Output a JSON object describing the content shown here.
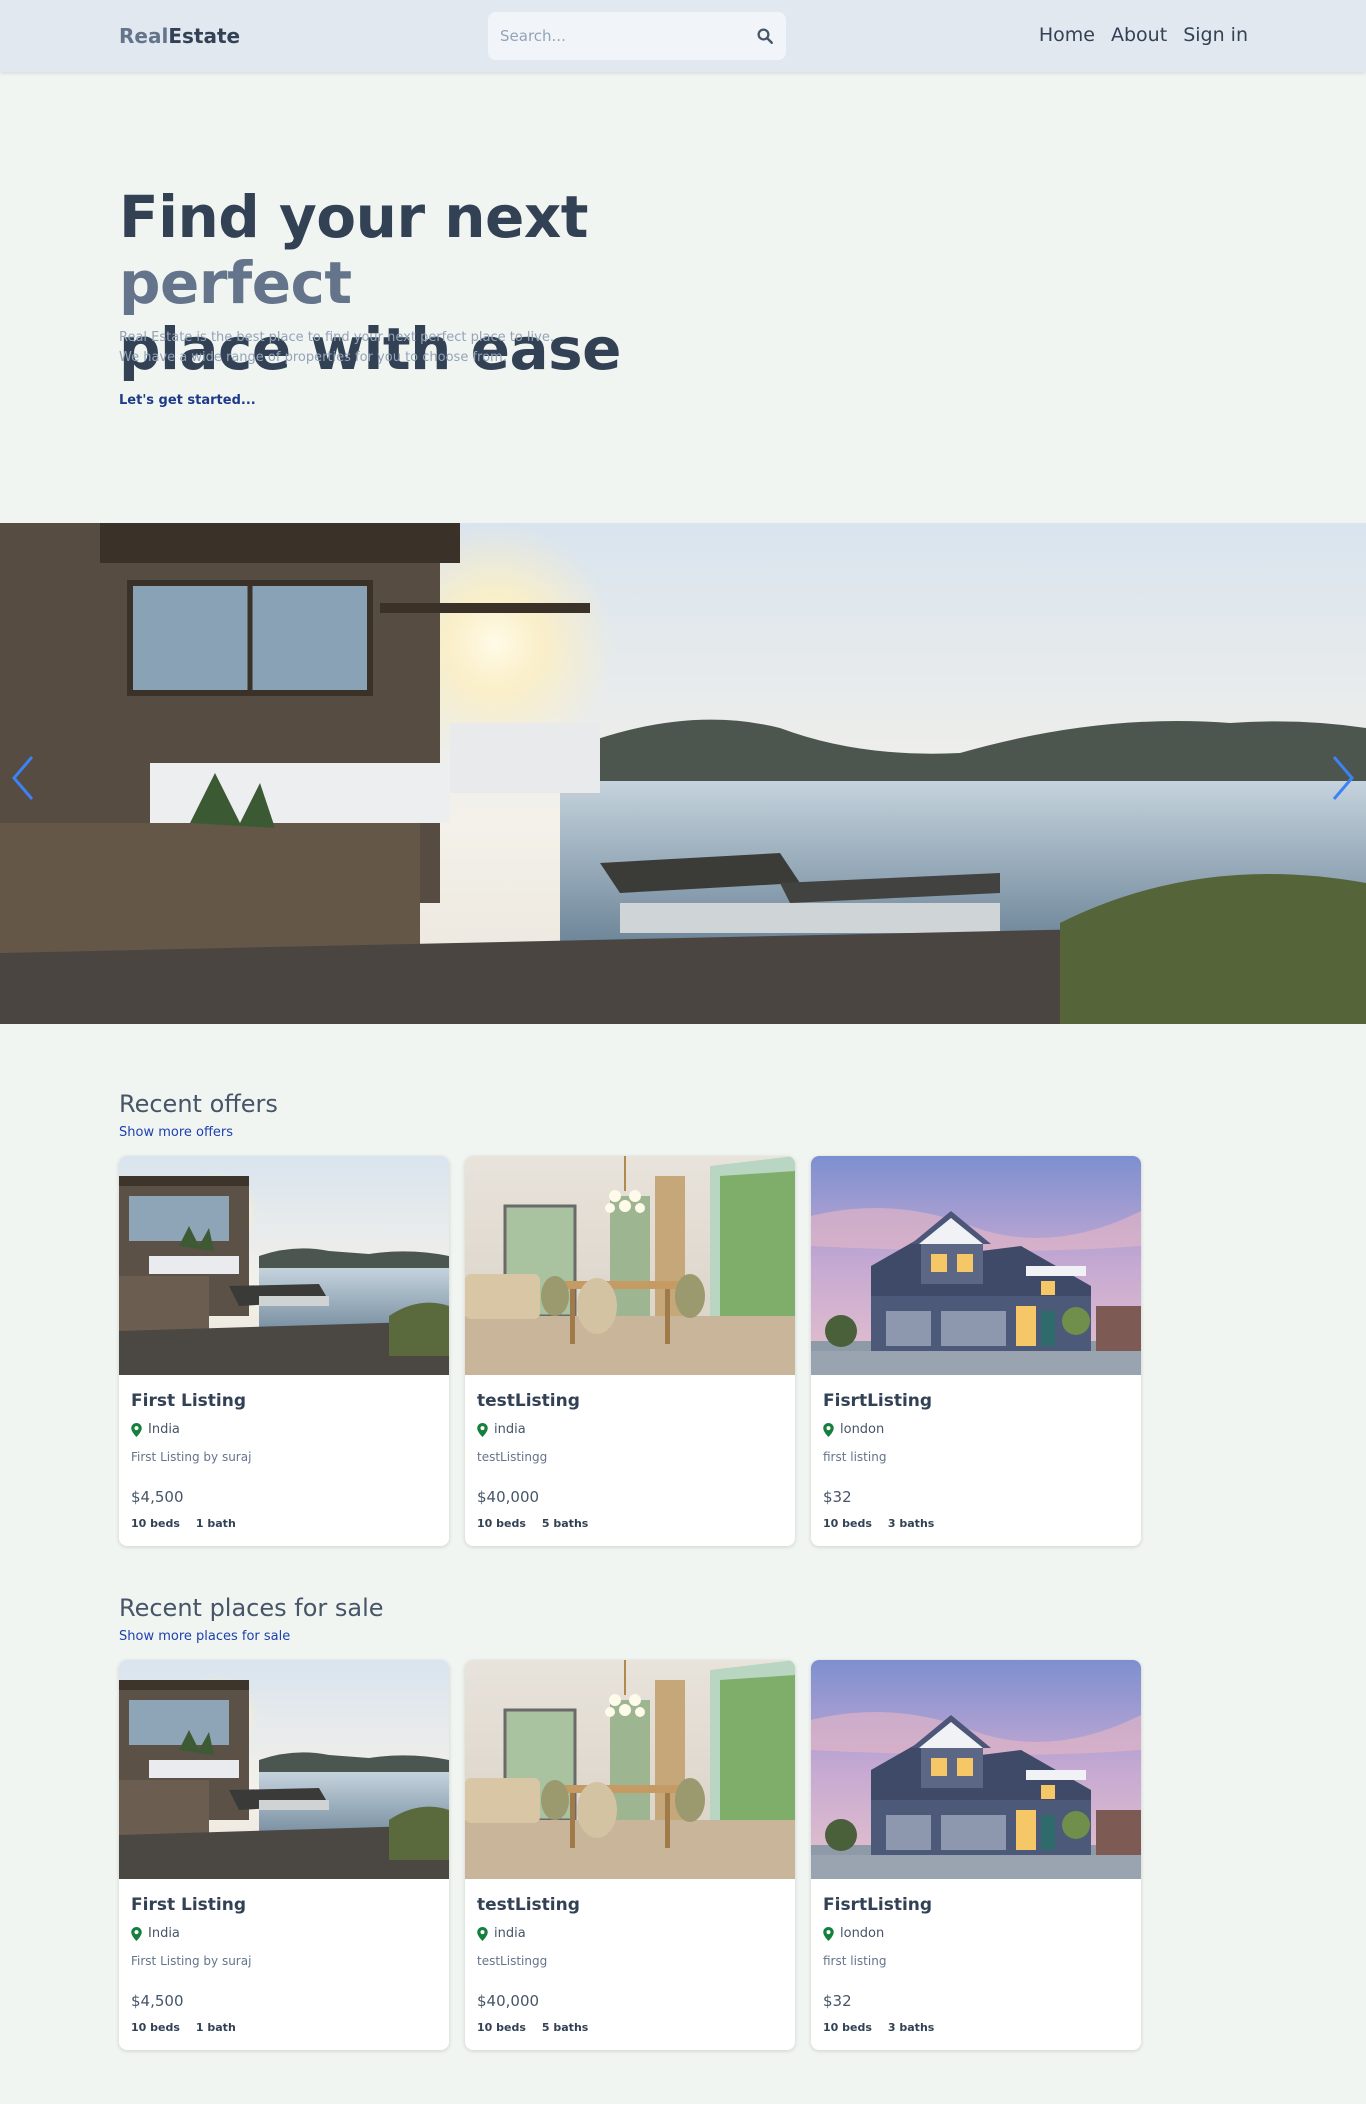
{
  "header": {
    "logo_part1": "Real",
    "logo_part2": "Estate",
    "search_placeholder": "Search...",
    "nav": [
      "Home",
      "About",
      "Sign in"
    ]
  },
  "hero": {
    "title_part1": "Find your next ",
    "title_highlight": "perfect",
    "title_part2": "place with ease",
    "subtitle_line1": "Real Estate is the best place to find your next perfect place to live.",
    "subtitle_line2": "We have a wide range of properties for you to choose from.",
    "cta": "Let's get started..."
  },
  "offers": {
    "title": "Recent offers",
    "link": "Show more offers",
    "listings": [
      {
        "name": "First Listing",
        "location": "India",
        "description": "First Listing by suraj",
        "price": "$4,500",
        "beds": "10 beds",
        "baths": "1 bath",
        "image": "villa"
      },
      {
        "name": "testListing",
        "location": "india",
        "description": "testListingg",
        "price": "$40,000",
        "beds": "10 beds",
        "baths": "5 baths",
        "image": "interior"
      },
      {
        "name": "FisrtListing",
        "location": "london",
        "description": "first listing",
        "price": "$32",
        "beds": "10 beds",
        "baths": "3 baths",
        "image": "house"
      }
    ]
  },
  "sale": {
    "title": "Recent places for sale",
    "link": "Show more places for sale",
    "listings": [
      {
        "name": "First Listing",
        "location": "India",
        "description": "First Listing by suraj",
        "price": "$4,500",
        "beds": "10 beds",
        "baths": "1 bath",
        "image": "villa"
      },
      {
        "name": "testListing",
        "location": "india",
        "description": "testListingg",
        "price": "$40,000",
        "beds": "10 beds",
        "baths": "5 baths",
        "image": "interior"
      },
      {
        "name": "FisrtListing",
        "location": "london",
        "description": "first listing",
        "price": "$32",
        "beds": "10 beds",
        "baths": "3 baths",
        "image": "house"
      }
    ]
  },
  "icons": {
    "search": "search-icon",
    "location": "map-pin-icon",
    "prev": "chevron-left-icon",
    "next": "chevron-right-icon"
  },
  "colors": {
    "accent": "#64748b",
    "text": "#334155",
    "link": "#1e40af",
    "pin": "#15803d"
  }
}
